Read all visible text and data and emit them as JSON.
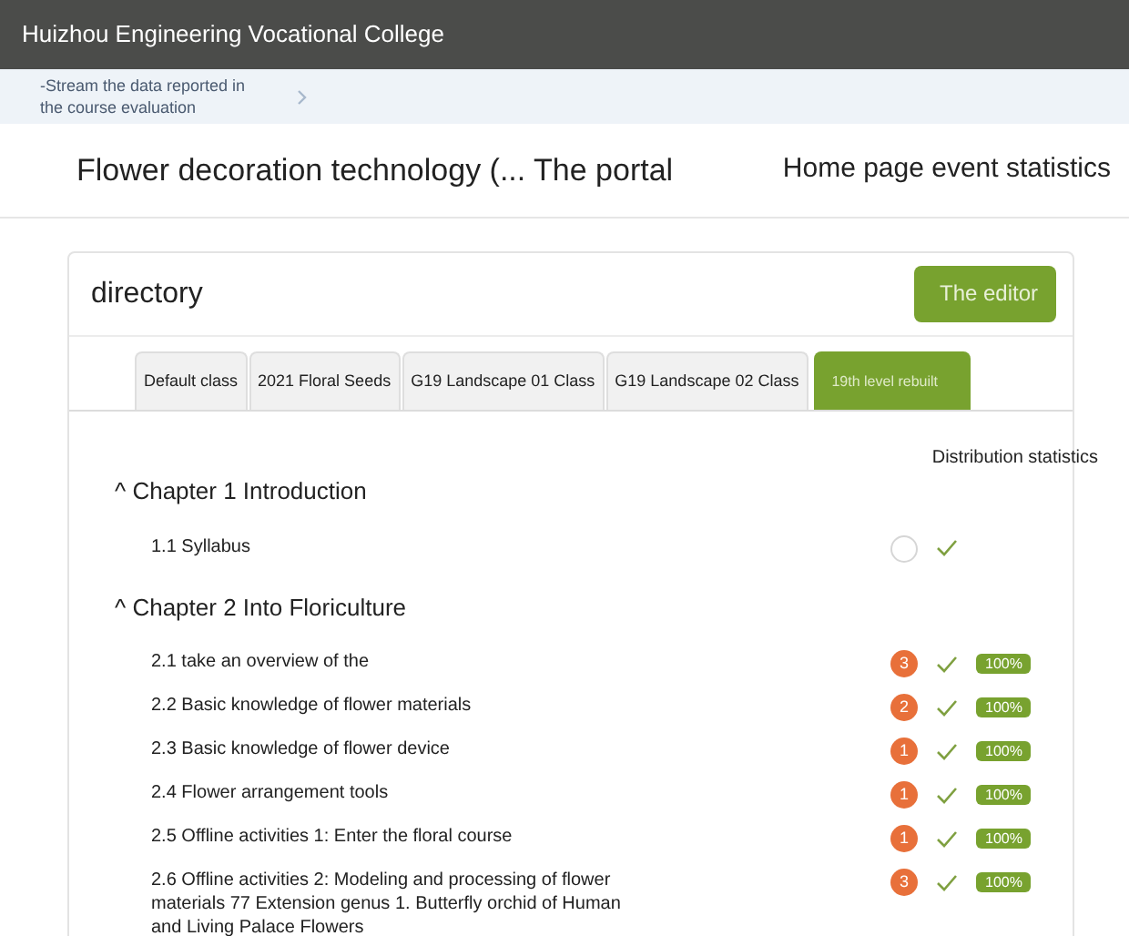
{
  "header": {
    "title": "Huizhou Engineering Vocational College"
  },
  "breadcrumb": {
    "text": "-Stream the data reported in the course evaluation"
  },
  "page": {
    "title": "Flower decoration technology (... The portal",
    "link": "Home page event statistics"
  },
  "directory": {
    "title": "directory",
    "editor_button": "The editor",
    "tabs": [
      {
        "label": "Default class",
        "selected": false
      },
      {
        "label": "2021 Floral Seeds",
        "selected": false
      },
      {
        "label": "G19 Landscape 01 Class",
        "selected": false
      },
      {
        "label": "G19 Landscape 02 Class",
        "selected": false
      },
      {
        "label": "19th level rebuilt",
        "selected": true
      }
    ],
    "stats_heading": "Distribution statistics",
    "chapters": [
      {
        "title": "^ Chapter 1 Introduction",
        "children": [
          {
            "title": "1.1 Syllabus",
            "done": true
          }
        ]
      },
      {
        "title": "^ Chapter 2 Into Floriculture",
        "children": [
          {
            "title": "2.1 take an overview of the",
            "count": "3",
            "done": true,
            "percent": "100%"
          },
          {
            "title": "2.2 Basic knowledge of flower materials",
            "count": "2",
            "done": true,
            "percent": "100%"
          },
          {
            "title": "2.3 Basic knowledge of flower device",
            "count": "1",
            "done": true,
            "percent": "100%"
          },
          {
            "title": "2.4 Flower arrangement tools",
            "count": "1",
            "done": true,
            "percent": "100%"
          },
          {
            "title": "2.5 Offline activities 1: Enter the floral course",
            "count": "1",
            "done": true,
            "percent": "100%"
          },
          {
            "title": "2.6 Offline activities 2: Modeling and processing of flower materials 77 Extension genus 1. Butterfly orchid of Human and Living Palace Flowers",
            "count": "3",
            "done": true,
            "percent": "100%"
          }
        ]
      }
    ]
  }
}
